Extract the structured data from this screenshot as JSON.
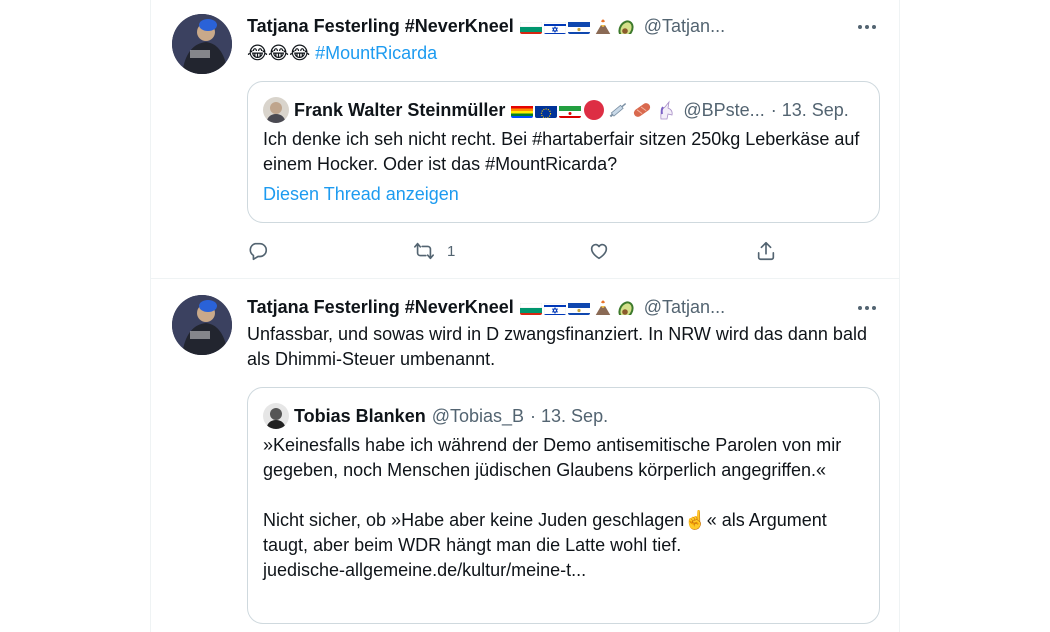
{
  "tweets": [
    {
      "author_name": "Tatjana Festerling #NeverKneel",
      "author_handle": "@Tatjan...",
      "body_emojis": "😂😂😂",
      "body_hashtag": "#MountRicarda",
      "quote": {
        "author_name": "Frank Walter Steinmüller",
        "author_handle": "@BPste...",
        "date": "· 13. Sep.",
        "text": "Ich denke ich seh nicht recht. Bei #hartaberfair sitzen 250kg Leberkäse auf einem Hocker. Oder ist das #MountRicarda?",
        "show_thread": "Diesen Thread anzeigen"
      },
      "actions": {
        "retweet_count": "1"
      }
    },
    {
      "author_name": "Tatjana Festerling #NeverKneel",
      "author_handle": "@Tatjan...",
      "body_text": "Unfassbar, und sowas wird in D zwangsfinanziert. In NRW wird das dann bald als Dhimmi-Steuer umbenannt.",
      "quote": {
        "author_name": "Tobias Blanken",
        "author_handle": "@Tobias_B",
        "date": "· 13. Sep.",
        "text_para1": "»Keinesfalls habe ich während der Demo antisemitische Parolen von mir gegeben, noch Menschen jüdischen Glaubens körperlich angegriffen.«",
        "text_para2_a": "Nicht sicher, ob »Habe aber keine Juden geschlagen",
        "text_para2_emoji": "☝️",
        "text_para2_b": "« als Argument taugt, aber beim WDR hängt man die Latte wohl tief.",
        "text_para2_link": "juedische-allgemeine.de/kultur/meine-t..."
      }
    }
  ],
  "colors": {
    "accent": "#1d9bf0",
    "secondary_text": "#536471",
    "border": "#cfd9de"
  },
  "icons": [
    "more-icon",
    "reply-icon",
    "retweet-icon",
    "like-icon",
    "share-icon"
  ]
}
